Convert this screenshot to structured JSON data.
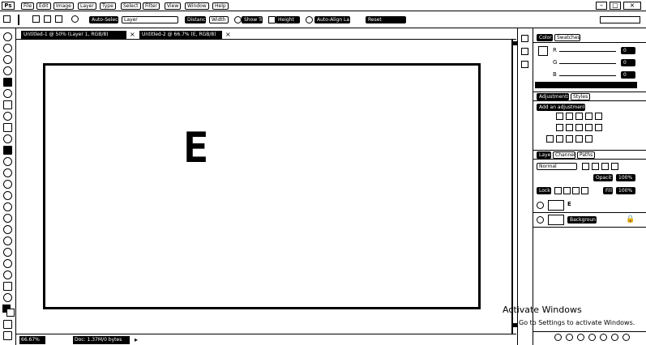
{
  "app": {
    "logo": "Ps"
  },
  "menu": [
    "File",
    "Edit",
    "Image",
    "Layer",
    "Type",
    "Select",
    "Filter",
    "View",
    "Window",
    "Help"
  ],
  "options_bar": {
    "auto_select": "Auto-Select:",
    "auto_select_value": "Layer",
    "transform": "Show Transform Controls",
    "distance": "Distance",
    "width": "Width",
    "height": "Height",
    "auto_align": "Auto-Align Layers",
    "reset": "Reset"
  },
  "window_controls": {
    "minimize": "–",
    "maximize": "□",
    "close": "×"
  },
  "tabs": [
    {
      "label": "Untitled-1 @ 50% (Layer 1, RGB/8)",
      "close": "×"
    },
    {
      "label": "Untitled-2 @ 66.7% (E, RGB/8)",
      "close": "×"
    }
  ],
  "canvas": {
    "letter": "E"
  },
  "status_bar": {
    "zoom": "66.67%",
    "doc": "Doc: 1.37M/0 bytes"
  },
  "panels": {
    "color_tabs": [
      "Color",
      "Swatches"
    ],
    "channels": [
      "R",
      "G",
      "B"
    ],
    "channel_values": [
      "0",
      "0",
      "0"
    ],
    "adjust_tabs": [
      "Adjustments",
      "Styles"
    ],
    "add_adjustment": "Add an adjustment",
    "layers_tabs": [
      "Layers",
      "Channels",
      "Paths"
    ],
    "blend_mode": "Normal",
    "opacity_label": "Opacity:",
    "opacity": "100%",
    "lock_label": "Lock:",
    "fill_label": "Fill:",
    "fill": "100%",
    "layers": [
      {
        "name": "E",
        "type": "text"
      },
      {
        "name": "Background",
        "type": "background"
      }
    ]
  },
  "watermark": {
    "title": "Activate Windows",
    "subtitle": "Go to Settings to activate Windows."
  }
}
